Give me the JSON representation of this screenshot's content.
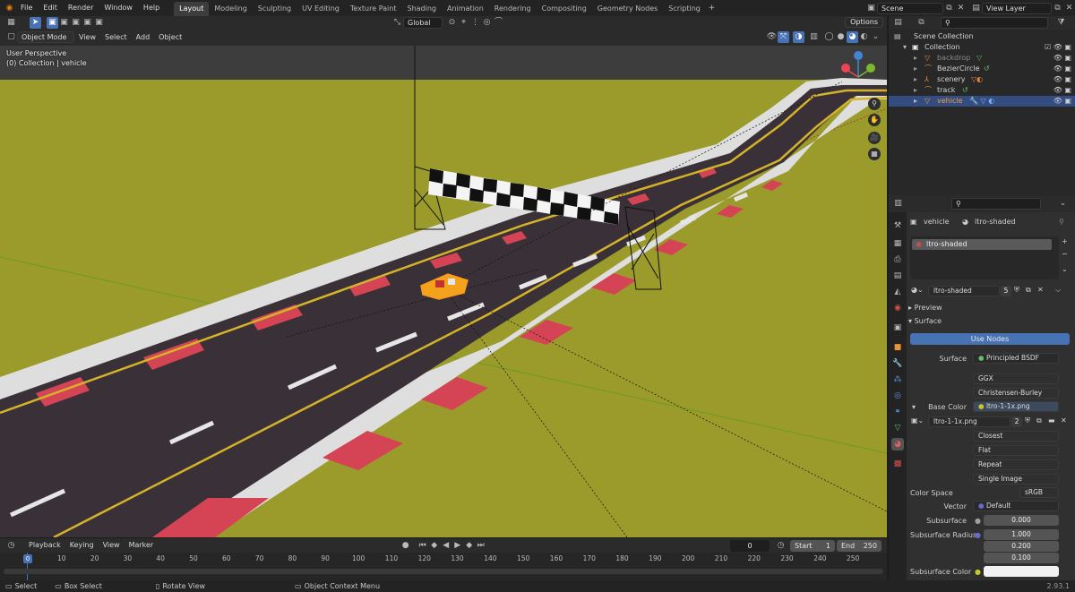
{
  "topbar": {
    "menus": [
      "File",
      "Edit",
      "Render",
      "Window",
      "Help"
    ],
    "workspaces": [
      "Layout",
      "Modeling",
      "Sculpting",
      "UV Editing",
      "Texture Paint",
      "Shading",
      "Animation",
      "Rendering",
      "Compositing",
      "Geometry Nodes",
      "Scripting"
    ],
    "active_workspace": "Layout",
    "scene": "Scene",
    "view_layer": "View Layer"
  },
  "tool_header": {
    "orientation": "Global",
    "options": "Options"
  },
  "viewport_header": {
    "mode": "Object Mode",
    "menus": [
      "View",
      "Select",
      "Add",
      "Object"
    ]
  },
  "viewport": {
    "view_name": "User Perspective",
    "collection_info": "(0) Collection | vehicle",
    "colors": {
      "ground": "#9a9b2a",
      "road": "#3a3138",
      "curb_red": "#d44455",
      "curb_white": "#dedede",
      "line_yellow": "#d4b22a"
    }
  },
  "outliner": {
    "root": "Scene Collection",
    "collection": "Collection",
    "items": [
      {
        "name": "backdrop",
        "disabled": true
      },
      {
        "name": "BezierCircle",
        "disabled": false
      },
      {
        "name": "scenery",
        "disabled": false
      },
      {
        "name": "track",
        "disabled": false
      },
      {
        "name": "vehicle",
        "disabled": false,
        "selected": true
      }
    ]
  },
  "properties": {
    "breadcrumb_object": "vehicle",
    "breadcrumb_material": "ltro-shaded",
    "material_slot": "ltro-shaded",
    "material_name": "ltro-shaded",
    "material_users": "5",
    "panels": {
      "preview": "Preview",
      "surface": "Surface"
    },
    "use_nodes": "Use Nodes",
    "surface_label": "Surface",
    "surface_value": "Principled BSDF",
    "distribution": "GGX",
    "subsurface_method": "Christensen-Burley",
    "base_color_label": "Base Color",
    "base_color_value": "ltro-1-1x.png",
    "image_name": "ltro-1-1x.png",
    "image_users": "2",
    "interpolation": "Closest",
    "projection": "Flat",
    "extension": "Repeat",
    "source": "Single Image",
    "color_space_label": "Color Space",
    "color_space_value": "sRGB",
    "vector_label": "Vector",
    "vector_value": "Default",
    "subsurface_label": "Subsurface",
    "subsurface_value": "0.000",
    "subsurface_radius_label": "Subsurface Radius",
    "subsurface_radius": [
      "1.000",
      "0.200",
      "0.100"
    ],
    "subsurface_color_label": "Subsurface Color"
  },
  "timeline": {
    "menus": [
      "Playback",
      "Keying",
      "View",
      "Marker"
    ],
    "current_frame": "0",
    "start_label": "Start",
    "start": "1",
    "end_label": "End",
    "end": "250",
    "ticks": [
      "0",
      "10",
      "20",
      "30",
      "40",
      "50",
      "60",
      "70",
      "80",
      "90",
      "100",
      "110",
      "120",
      "130",
      "140",
      "150",
      "160",
      "170",
      "180",
      "190",
      "200",
      "210",
      "220",
      "230",
      "240",
      "250"
    ]
  },
  "statusbar": {
    "items": [
      "Select",
      "Box Select",
      "Rotate View",
      "Object Context Menu"
    ],
    "version": "2.93.1"
  }
}
